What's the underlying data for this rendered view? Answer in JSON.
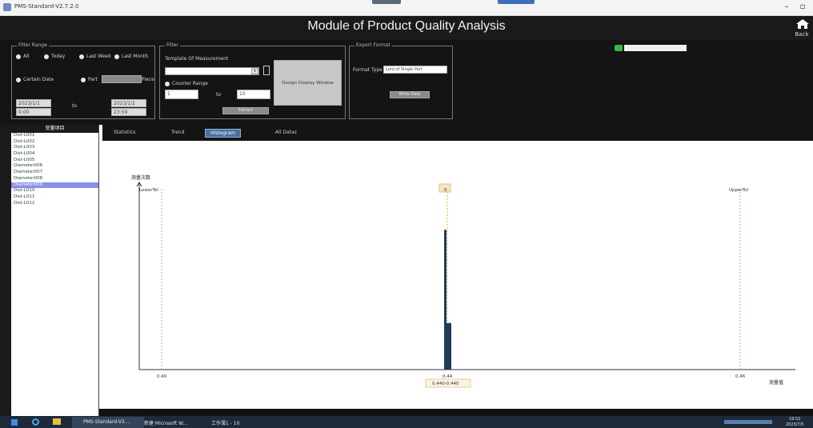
{
  "window": {
    "title": "PMS-Standard-V2.7.2.0",
    "min": "–",
    "restore": "▫"
  },
  "header": {
    "title": "Module of Product Quality Analysis",
    "back_label": "Back"
  },
  "filter_range": {
    "title": "Filter Range",
    "opt_all": "All",
    "opt_today": "Today",
    "opt_last_week": "Last Week",
    "opt_last_month": "Last Month",
    "opt_certain_date": "Certain Date",
    "opt_part": "Part",
    "piece_label": "Piece",
    "date_from": "2023/1/1",
    "time_from": "0:00",
    "date_to": "2023/1/2",
    "time_to": "23:59",
    "to_label": "to"
  },
  "filter": {
    "title": "Filter",
    "template_label": "Template Of Measurement",
    "counter_range_label": "Counter Range",
    "counter_from": "1",
    "counter_to": "10",
    "to_label": "to",
    "design_button": "Design Display Window",
    "extract_button": "Extract"
  },
  "export": {
    "title": "Export Format",
    "format_label": "Format Type",
    "format_value": "Lord of Single Part",
    "write_button": "Write Data"
  },
  "tabs": [
    {
      "label": "Statistics",
      "active": false
    },
    {
      "label": "Trend",
      "active": false
    },
    {
      "label": "Histogram",
      "active": true
    },
    {
      "label": "All Datas",
      "active": false
    }
  ],
  "sidebar": {
    "header": "变量项目",
    "items": [
      "Dist-L001",
      "Dist-L002",
      "Dist-L003",
      "Dist-L004",
      "Dist-L005",
      "Diameter006",
      "Diameter007",
      "Diameter008",
      "Diameter009",
      "Dist-L010",
      "Dist-L011",
      "Dist-L012"
    ],
    "selected_index": 8
  },
  "chart_data": {
    "type": "bar",
    "ylabel": "测量次数",
    "xlabel": "测量值",
    "x_ticks": [
      "0.40",
      "0.44",
      "0.46"
    ],
    "ref_lines": [
      {
        "label": "LowerTol",
        "x": 0.4
      },
      {
        "label": "0",
        "x": 0.44
      },
      {
        "label": "UpperTol",
        "x": 0.48
      }
    ],
    "bars": [
      {
        "x": 0.4398,
        "height": 0.78
      },
      {
        "x": 0.44,
        "height": 0.26
      },
      {
        "x": 0.4402,
        "height": 0.26
      }
    ],
    "range_readout": "0.440-0.440",
    "colors": {
      "bar": "#1f3c5a",
      "ref_line": "#e2a37a",
      "mean_line": "#e0b020"
    }
  },
  "taskbar": {
    "items": [
      "PMS-Standard-V2...",
      "新建 Microsoft W...",
      "工作薄1 - 10"
    ],
    "time": "19:52",
    "date": "2023/7/5"
  }
}
